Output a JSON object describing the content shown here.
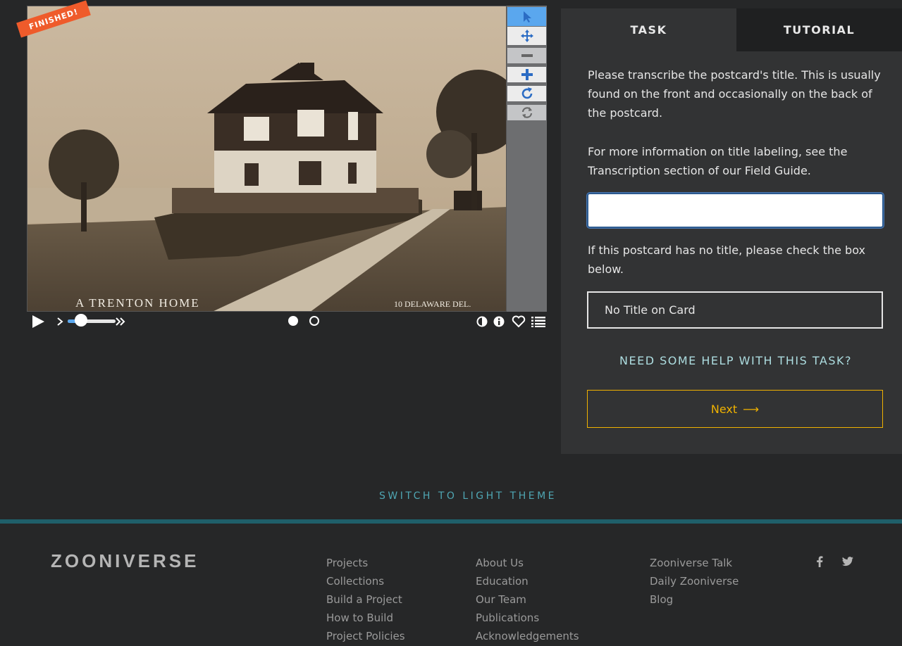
{
  "viewer": {
    "finished_badge": "FINISHED!",
    "photo_caption_left": "A TRENTON HOME",
    "photo_caption_right": "10 DELAWARE DEL.",
    "tools": [
      "pointer-icon",
      "move-icon",
      "zoom-out-icon",
      "zoom-in-icon",
      "rotate-icon",
      "reset-icon"
    ],
    "controls": [
      "play-icon",
      "step-forward-icon",
      "fast-forward-icon",
      "invert-icon",
      "info-icon",
      "heart-icon",
      "list-icon"
    ],
    "playback_speed_fraction": 0.2,
    "frames": 2,
    "active_frame": 1
  },
  "panel": {
    "tabs": {
      "task": "TASK",
      "tutorial": "TUTORIAL"
    },
    "instruction_1": "Please transcribe the postcard's title. This is usually found on the front and occasionally on the back of the postcard.",
    "instruction_2": "For more information on title labeling, see the Transcription section of our Field Guide.",
    "answer_value": "",
    "instruction_3": "If this postcard has no title, please check the box below.",
    "no_title_label": "No Title on Card",
    "help_label": "NEED SOME HELP WITH THIS TASK?",
    "next_label": "Next",
    "next_arrow": "⟶"
  },
  "theme_switch": "SWITCH TO LIGHT THEME",
  "footer": {
    "logo": "ZOONIVERSE",
    "col1": [
      "Projects",
      "Collections",
      "Build a Project",
      "How to Build",
      "Project Policies"
    ],
    "col2": [
      "About Us",
      "Education",
      "Our Team",
      "Publications",
      "Acknowledgements"
    ],
    "col3": [
      "Zooniverse Talk",
      "Daily Zooniverse",
      "Blog"
    ],
    "social": [
      "facebook-icon",
      "twitter-icon"
    ]
  },
  "colors": {
    "background": "#262728",
    "panel": "#323334",
    "accent_blue": "#5aa7ee",
    "next_gold": "#f0b200",
    "help_teal": "#addde0",
    "finished_orange": "#ef5b2b",
    "footer_rule": "#1f5f6a"
  }
}
